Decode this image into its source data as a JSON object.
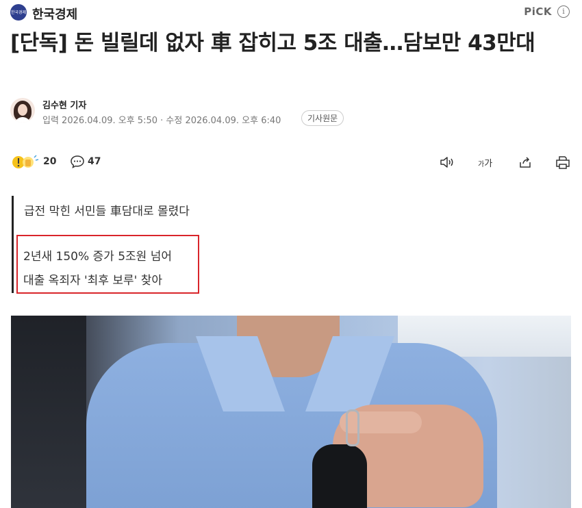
{
  "press": {
    "name": "한국경제",
    "logo_text": "한국경제"
  },
  "pick_label": "PiCK",
  "info_glyph": "i",
  "headline": "[단독] 돈 빌릴데 없자 車 잡히고 5조 대출…담보만 43만대",
  "byline": {
    "reporter": "김수현 기자",
    "dates": "입력 2026.04.09. 오후 5:50 · 수정 2026.04.09. 오후 6:40",
    "original_link": "기사원문"
  },
  "actions": {
    "reaction_count": "20",
    "comment_count": "47",
    "font_size_label": "가"
  },
  "summary": {
    "line1": "급전 막힌 서민들 車담대로 몰렸다",
    "line2": "2년새 150% 증가 5조원 넘어",
    "line3": "대출 옥죄자 '최후 보루' 찾아"
  },
  "colors": {
    "highlight": "#d9252a",
    "logo": "#2e3f8f"
  }
}
